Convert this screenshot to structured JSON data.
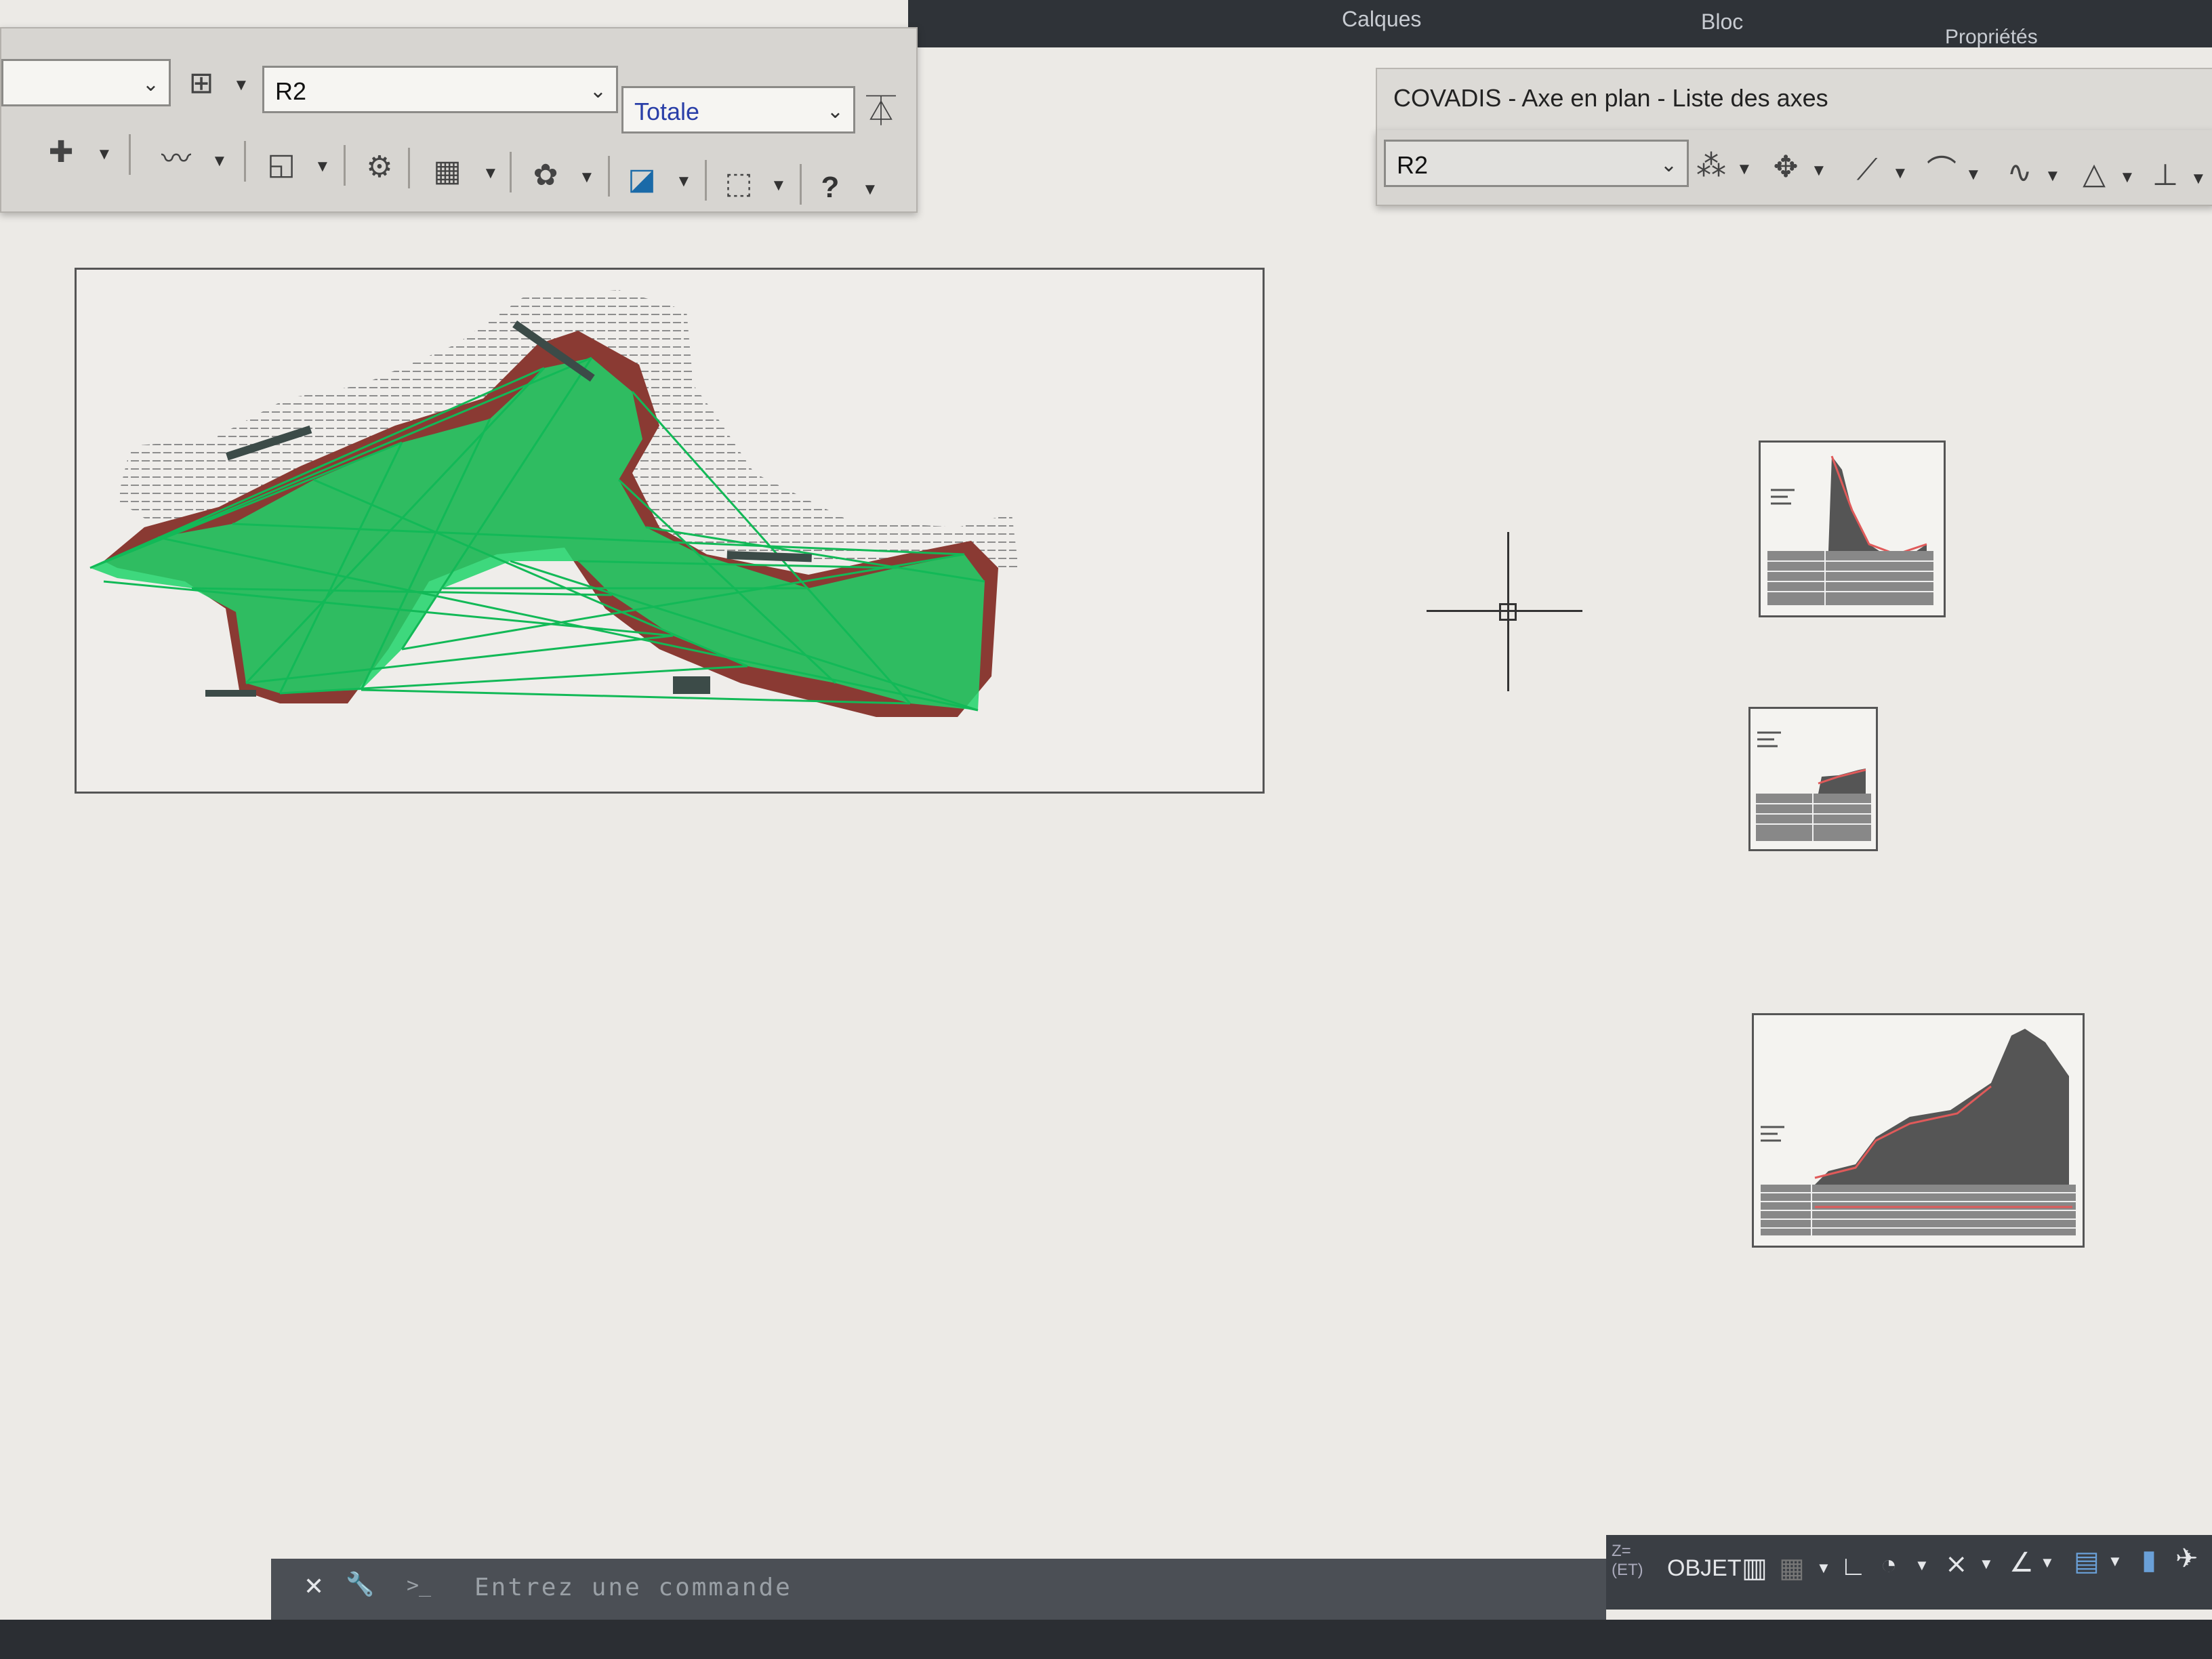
{
  "ribbon": {
    "items": [
      "Calques",
      "Bloc",
      "Propriétés"
    ]
  },
  "left_toolbar": {
    "axis_select": "R2",
    "mode_select": "Totale",
    "help_glyph": "?"
  },
  "axis_panel": {
    "title": "COVADIS - Axe en plan - Liste des axes",
    "axis_select": "R2"
  },
  "command": {
    "placeholder": "Entrez une commande",
    "close_glyph": "✕",
    "wrench_glyph": "🔧",
    "prompt_glyph": ">_"
  },
  "status": {
    "z_label": "Z=\n(ET)",
    "object_mode": "OBJET"
  },
  "colors": {
    "tin_green": "#1fd36a",
    "terrain_brown": "#8a3a33",
    "hatch_gray": "#8d8d8d",
    "profile_red": "#e05a5a"
  },
  "icons": [
    "layers-icon",
    "pan-icon",
    "gear-icon",
    "profile-icon",
    "help-icon",
    "move-icon",
    "line-icon",
    "arc-icon"
  ]
}
